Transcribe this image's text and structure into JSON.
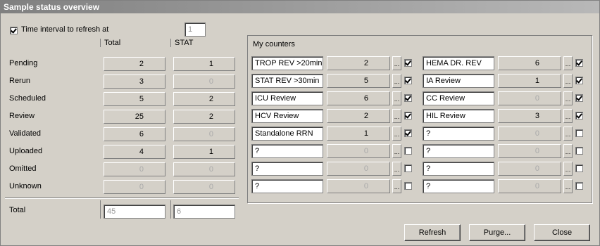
{
  "window": {
    "title": "Sample status overview"
  },
  "refresh": {
    "label": "Time interval to refresh at",
    "checked": true,
    "value": "1"
  },
  "columns": {
    "total": "Total",
    "stat": "STAT"
  },
  "rows": [
    {
      "label": "Pending",
      "total": "2",
      "stat": "1",
      "total_dim": false,
      "stat_dim": false
    },
    {
      "label": "Rerun",
      "total": "3",
      "stat": "0",
      "total_dim": false,
      "stat_dim": true
    },
    {
      "label": "Scheduled",
      "total": "5",
      "stat": "2",
      "total_dim": false,
      "stat_dim": false
    },
    {
      "label": "Review",
      "total": "25",
      "stat": "2",
      "total_dim": false,
      "stat_dim": false
    },
    {
      "label": "Validated",
      "total": "6",
      "stat": "0",
      "total_dim": false,
      "stat_dim": true
    },
    {
      "label": "Uploaded",
      "total": "4",
      "stat": "1",
      "total_dim": false,
      "stat_dim": false
    },
    {
      "label": "Omitted",
      "total": "0",
      "stat": "0",
      "total_dim": true,
      "stat_dim": true
    },
    {
      "label": "Unknown",
      "total": "0",
      "stat": "0",
      "total_dim": true,
      "stat_dim": true
    }
  ],
  "totals": {
    "label": "Total",
    "total": "45",
    "stat": "6"
  },
  "counters": {
    "title": "My counters",
    "ellipsis": "...",
    "left": [
      {
        "name": "TROP REV >20min",
        "count": "2",
        "checked": true,
        "dim": false
      },
      {
        "name": "STAT REV >30min",
        "count": "5",
        "checked": true,
        "dim": false
      },
      {
        "name": "ICU Review",
        "count": "6",
        "checked": true,
        "dim": false
      },
      {
        "name": "HCV Review",
        "count": "2",
        "checked": true,
        "dim": false
      },
      {
        "name": "Standalone RRN",
        "count": "1",
        "checked": true,
        "dim": false
      },
      {
        "name": "?",
        "count": "0",
        "checked": false,
        "dim": true
      },
      {
        "name": "?",
        "count": "0",
        "checked": false,
        "dim": true
      },
      {
        "name": "?",
        "count": "0",
        "checked": false,
        "dim": true
      }
    ],
    "right": [
      {
        "name": "HEMA DR. REV",
        "count": "6",
        "checked": true,
        "dim": false
      },
      {
        "name": "IA Review",
        "count": "1",
        "checked": true,
        "dim": false
      },
      {
        "name": "CC Review",
        "count": "0",
        "checked": true,
        "dim": true
      },
      {
        "name": "HIL Review",
        "count": "3",
        "checked": true,
        "dim": false
      },
      {
        "name": "?",
        "count": "0",
        "checked": false,
        "dim": true
      },
      {
        "name": "?",
        "count": "0",
        "checked": false,
        "dim": true
      },
      {
        "name": "?",
        "count": "0",
        "checked": false,
        "dim": true
      },
      {
        "name": "?",
        "count": "0",
        "checked": false,
        "dim": true
      }
    ]
  },
  "buttons": {
    "refresh": "Refresh",
    "purge": "Purge...",
    "close": "Close"
  }
}
